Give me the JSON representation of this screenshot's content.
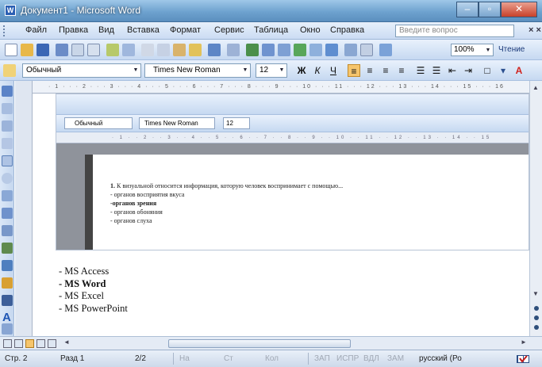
{
  "window": {
    "title": "Документ1 - Microsoft Word"
  },
  "menu": {
    "items": [
      "Файл",
      "Правка",
      "Вид",
      "Вставка",
      "Формат",
      "Сервис",
      "Таблица",
      "Окно",
      "Справка"
    ],
    "question_placeholder": "Введите вопрос",
    "close_glyph": "× ×"
  },
  "toolbar": {
    "zoom": "100%",
    "read_label": "Чтение",
    "style": "Обычный",
    "font": "Times New Roman",
    "size": "12",
    "bold": "Ж",
    "italic": "К",
    "underline": "Ч"
  },
  "embedded": {
    "style": "Обычный",
    "font": "Times New Roman",
    "size": "12",
    "question_num": "1.",
    "question_text": "К визуальной относится информация, которую человек воспринимает с помощью...",
    "options": [
      "- органов восприятия вкуса",
      "-органов зрения",
      "- органов обоняния",
      "- органов слуха"
    ],
    "bold_option_index": 1
  },
  "document": {
    "lines": [
      "- MS Access",
      "- MS Word",
      "- MS Excel",
      "- MS PowerPoint"
    ],
    "bold_line_index": 1
  },
  "status": {
    "page": "Стр. 2",
    "section": "Разд 1",
    "pages": "2/2",
    "at": "На",
    "line": "Ст",
    "col": "Кол",
    "rec": "ЗАП",
    "trk": "ИСПР",
    "ext": "ВДЛ",
    "ovr": "ЗАМ",
    "language": "русский (Ро"
  }
}
